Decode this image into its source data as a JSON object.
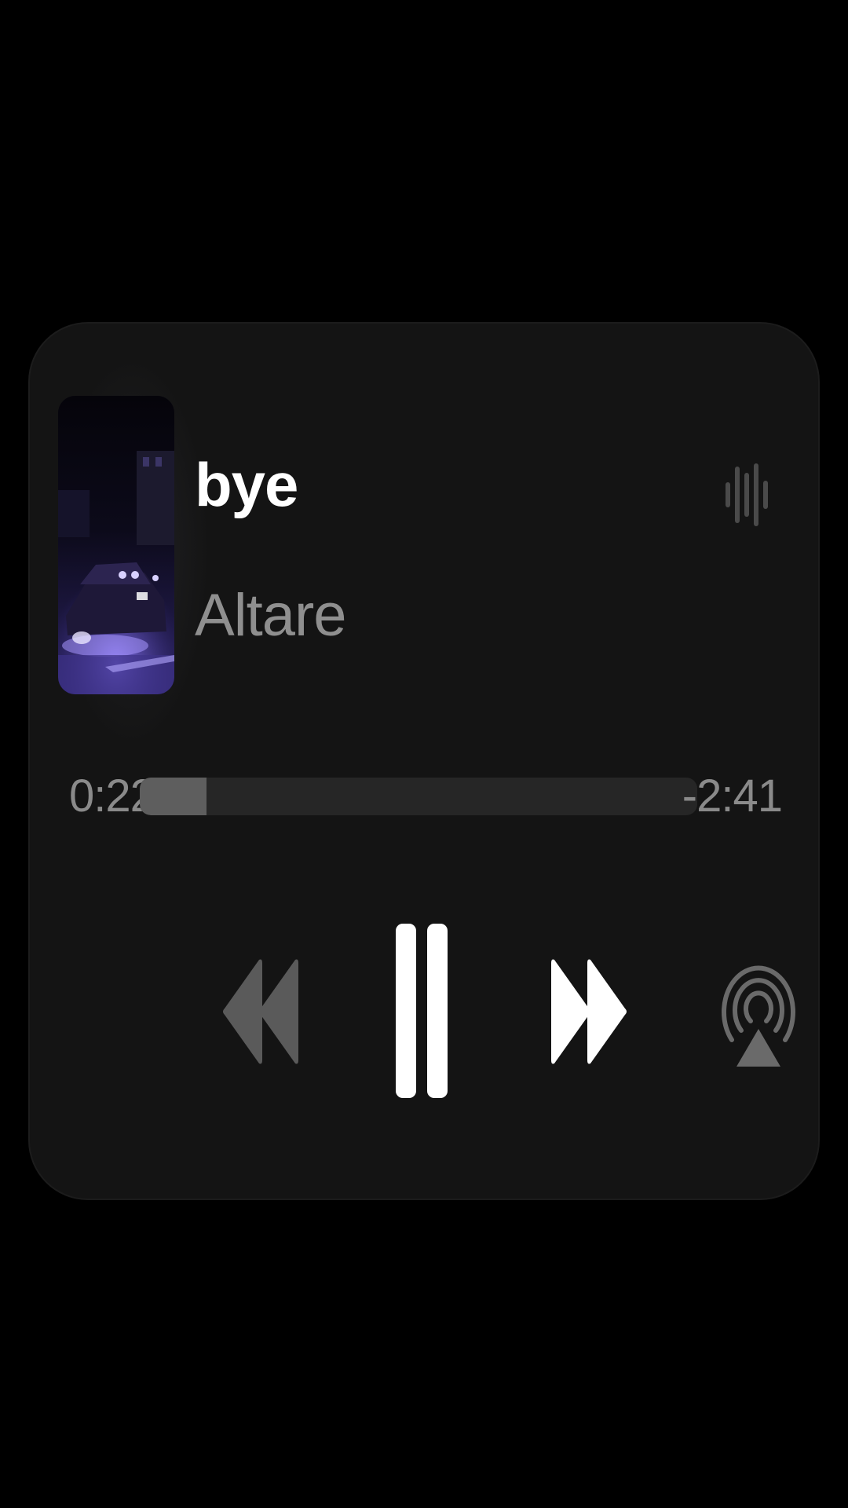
{
  "now_playing": {
    "title": "bye",
    "artist": "Altare"
  },
  "playback": {
    "elapsed": "0:22",
    "remaining": "-2:41",
    "progress_fraction": 0.12,
    "state": "playing"
  },
  "controls": {
    "rewind_icon": "rewind-icon",
    "pause_icon": "pause-icon",
    "forward_icon": "fast-forward-icon",
    "airplay_icon": "airplay-icon",
    "waveform_icon": "waveform-icon"
  },
  "colors": {
    "card_background": "#141414",
    "title": "#ffffff",
    "secondary_text": "#8f8f8f",
    "progress_fill": "#5e5e5e",
    "progress_track": "#262626",
    "artwork_tint": "#6b55d6"
  }
}
